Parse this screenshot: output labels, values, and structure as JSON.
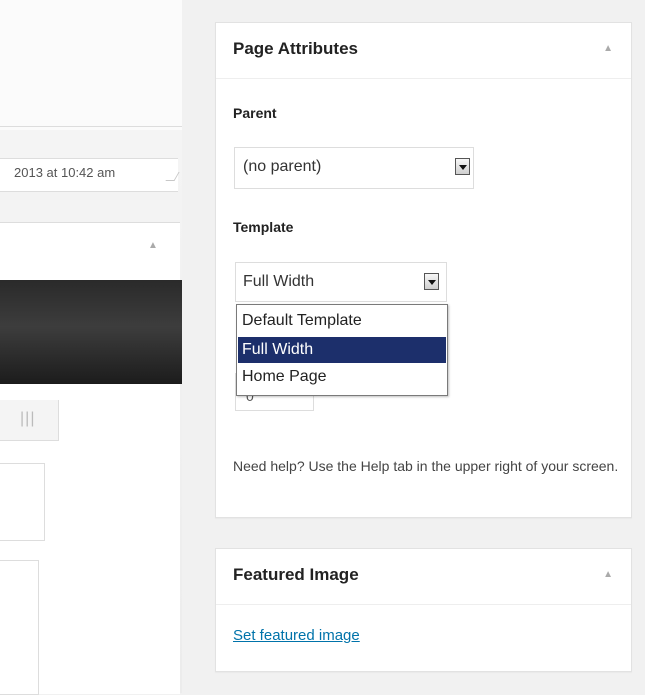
{
  "left_panel": {
    "date_text": "2013 at 10:42 am",
    "collapse_icon": "triangle-up-icon",
    "grid_icon": "grid-lines-icon"
  },
  "page_attributes": {
    "title": "Page Attributes",
    "collapse_icon": "triangle-up-icon",
    "parent_label": "Parent",
    "parent_value": "(no parent)",
    "template_label": "Template",
    "template_value": "Full Width",
    "template_options": [
      {
        "label": "Default Template",
        "selected": false
      },
      {
        "label": "Full Width",
        "selected": true
      },
      {
        "label": "Home Page",
        "selected": false
      }
    ],
    "order_value": "0",
    "help_text": "Need help? Use the Help tab in the upper right of your screen."
  },
  "featured_image": {
    "title": "Featured Image",
    "collapse_icon": "triangle-up-icon",
    "set_link": "Set featured image"
  },
  "colors": {
    "selected_option_bg": "#1c2f6b",
    "link": "#0073aa",
    "page_bg": "#f1f1f1"
  }
}
